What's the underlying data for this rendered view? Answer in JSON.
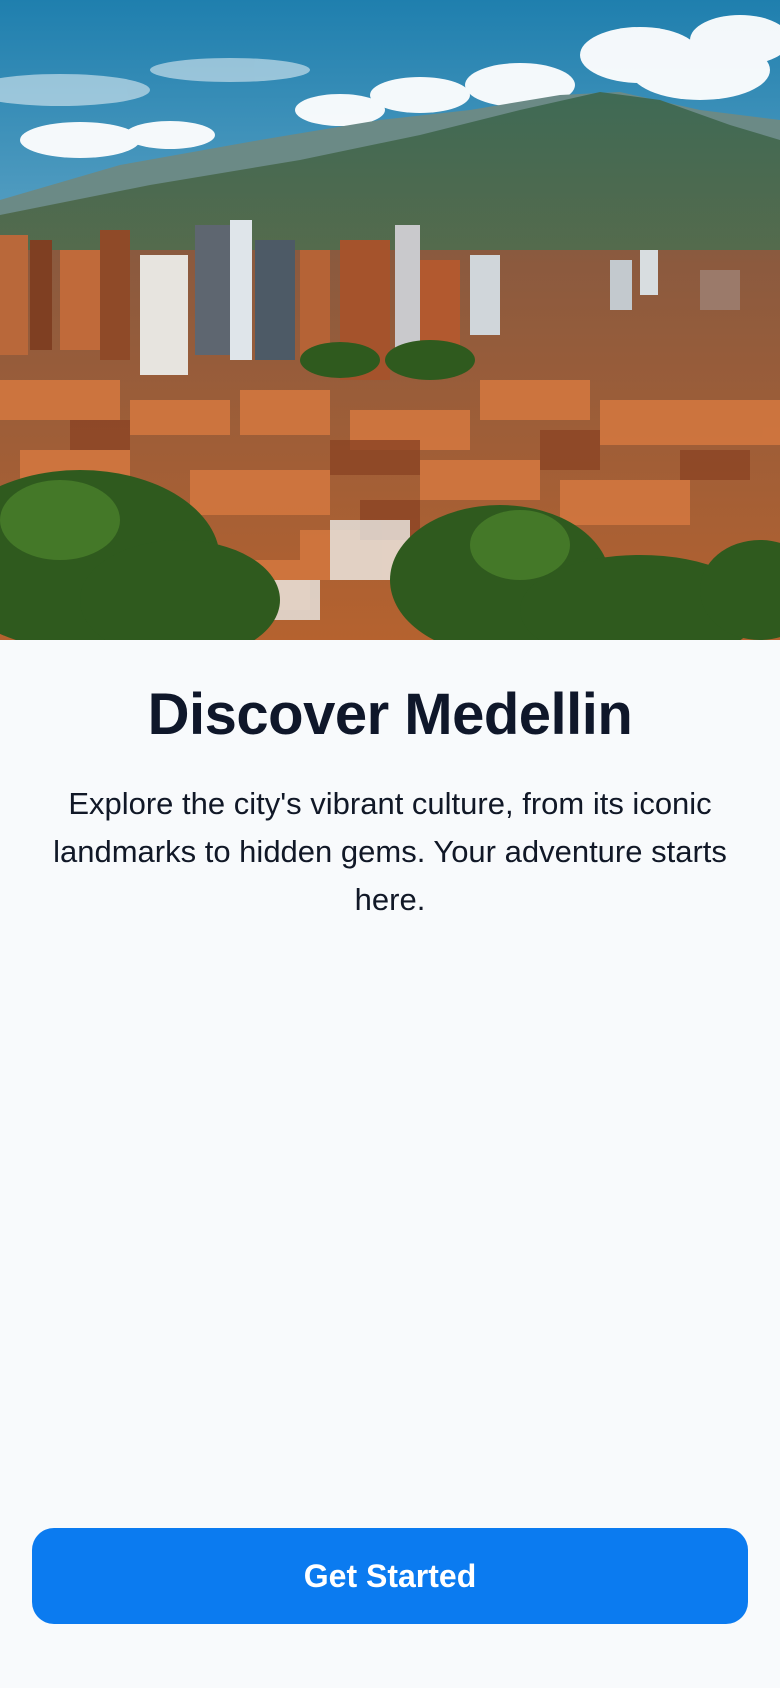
{
  "hero": {
    "image_name": "medellin-cityscape-photo",
    "colors": {
      "sky_top": "#1f7fae",
      "sky_bottom": "#b9d8e6",
      "mountain": "#3d5a48",
      "mountain_far": "#5f7f7a",
      "roof": "#c8703c",
      "brick": "#a1502b",
      "tree": "#2f5a1e"
    }
  },
  "main": {
    "title": "Discover Medellin",
    "description": "Explore the city's vibrant culture, from its iconic landmarks to hidden gems. Your adventure starts here."
  },
  "actions": {
    "get_started_label": "Get Started"
  },
  "theme": {
    "primary": "#0b7bf0",
    "background": "#f8fafc",
    "text": "#0f172a"
  }
}
